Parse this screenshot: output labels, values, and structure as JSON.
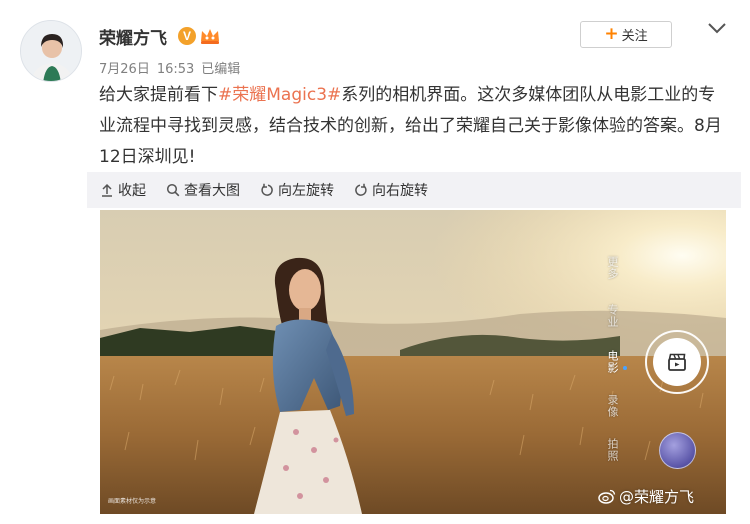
{
  "post": {
    "author": "荣耀方飞",
    "verified_icon": "v-verified-badge",
    "verified_mark": "V",
    "vip_icon": "vip-crown-badge",
    "date": "7月26日",
    "time": "16:53",
    "edited_label": "已编辑",
    "follow_label": "关注",
    "text_before": "给大家提前看下",
    "hashtag": "#荣耀Magic3#",
    "text_after": "系列的相机界面。这次多媒体团队从电影工业的专业流程中寻找到灵感，结合技术的创新，给出了荣耀自己关于影像体验的答案。8月12日深圳见!"
  },
  "toolbar": {
    "collapse_label": "收起",
    "view_large_label": "查看大图",
    "rotate_left_label": "向左旋转",
    "rotate_right_label": "向右旋转"
  },
  "camera_ui": {
    "modes": [
      "更多",
      "专业",
      "电影",
      "录像",
      "拍照"
    ],
    "active_mode": "电影",
    "sample_note": "画面素材仅为示意",
    "watermark": "@荣耀方飞",
    "active_dot_color": "#4aa3ff"
  },
  "colors": {
    "hashtag": "#eb7350",
    "follow_plus": "#ff8200",
    "toolbar_bg": "#f2f2f5"
  }
}
